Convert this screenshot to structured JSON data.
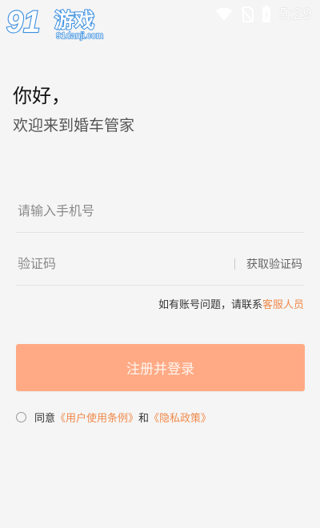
{
  "status_bar": {
    "time": "5:29",
    "icons": [
      "wifi-icon",
      "no-sim-icon",
      "battery-icon"
    ],
    "icon_color": "#ffffff"
  },
  "watermark": {
    "logo_number": "91",
    "logo_text": "游戏",
    "domain": "91danji.com",
    "logo_color": "#3b8fe0"
  },
  "header": {
    "greeting": "你好，",
    "subtitle": "欢迎来到婚车管家"
  },
  "form": {
    "phone_placeholder": "请输入手机号",
    "code_placeholder": "验证码",
    "get_code_label": "获取验证码"
  },
  "help": {
    "text": "如有账号问题，请联系",
    "link": "客服人员"
  },
  "submit": {
    "label": "注册并登录",
    "color": "#ffaa85"
  },
  "agreement": {
    "agree_text": "同意",
    "user_terms": "《用户使用条例》",
    "and_text": "和",
    "privacy_policy": "《隐私政策》",
    "link_color": "#f08a4b"
  }
}
